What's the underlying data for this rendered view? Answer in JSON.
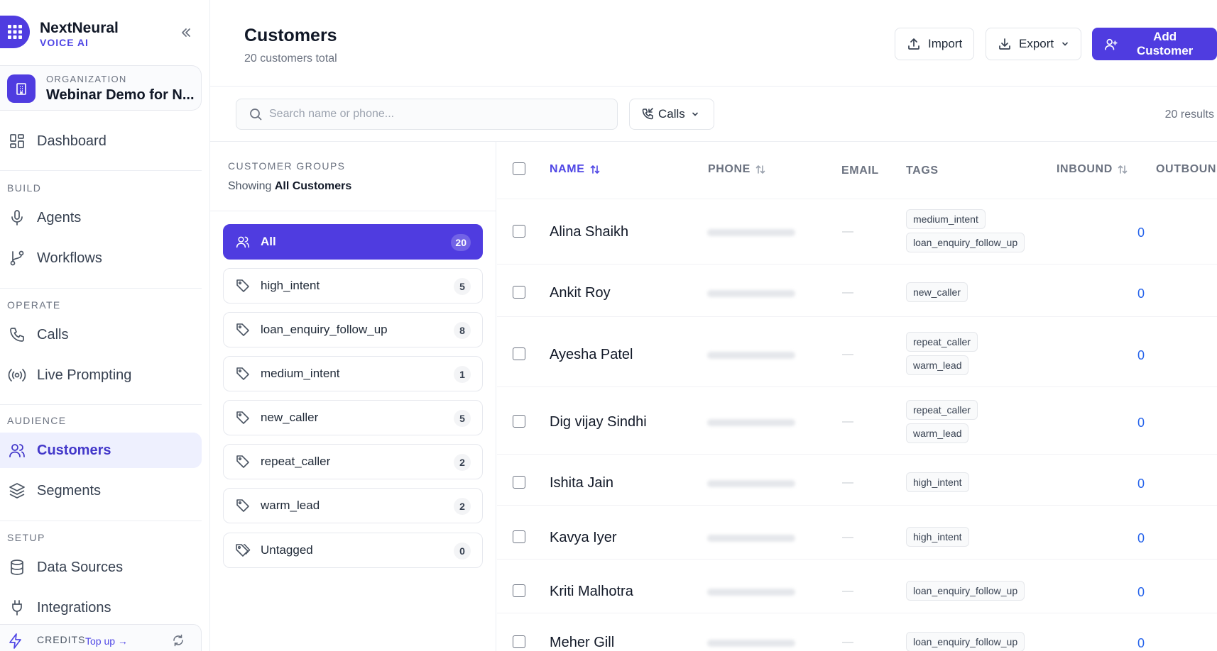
{
  "brand": {
    "name": "NextNeural",
    "tagline": "VOICE AI"
  },
  "org": {
    "label": "ORGANIZATION",
    "name": "Webinar Demo for N..."
  },
  "nav": {
    "dashboard": "Dashboard",
    "build_label": "BUILD",
    "agents": "Agents",
    "workflows": "Workflows",
    "operate_label": "OPERATE",
    "calls": "Calls",
    "live_prompting": "Live Prompting",
    "audience_label": "AUDIENCE",
    "customers": "Customers",
    "segments": "Segments",
    "setup_label": "SETUP",
    "data_sources": "Data Sources",
    "integrations": "Integrations"
  },
  "credits": {
    "label": "CREDITS",
    "topup": "Top up →"
  },
  "header": {
    "title": "Customers",
    "subtitle": "20 customers total",
    "import": "Import",
    "export": "Export",
    "add": "Add Customer"
  },
  "toolbar": {
    "search_placeholder": "Search name or phone...",
    "filter": "Calls",
    "results": "20 results"
  },
  "groups": {
    "title": "CUSTOMER GROUPS",
    "showing_prefix": "Showing",
    "showing_value": "All Customers",
    "items": [
      {
        "label": "All",
        "count": "20"
      },
      {
        "label": "high_intent",
        "count": "5"
      },
      {
        "label": "loan_enquiry_follow_up",
        "count": "8"
      },
      {
        "label": "medium_intent",
        "count": "1"
      },
      {
        "label": "new_caller",
        "count": "5"
      },
      {
        "label": "repeat_caller",
        "count": "2"
      },
      {
        "label": "warm_lead",
        "count": "2"
      },
      {
        "label": "Untagged",
        "count": "0"
      }
    ]
  },
  "table": {
    "columns": {
      "name": "NAME",
      "phone": "PHONE",
      "email": "EMAIL",
      "tags": "TAGS",
      "inbound": "INBOUND",
      "outbound": "OUTBOUND"
    },
    "rows": [
      {
        "name": "Alina Shaikh",
        "email": "—",
        "tags": [
          "medium_intent",
          "loan_enquiry_follow_up"
        ],
        "inbound": "0"
      },
      {
        "name": "Ankit Roy",
        "email": "—",
        "tags": [
          "new_caller"
        ],
        "inbound": "0"
      },
      {
        "name": "Ayesha Patel",
        "email": "—",
        "tags": [
          "repeat_caller",
          "warm_lead"
        ],
        "inbound": "0"
      },
      {
        "name": "Dig vijay Sindhi",
        "email": "—",
        "tags": [
          "repeat_caller",
          "warm_lead"
        ],
        "inbound": "0"
      },
      {
        "name": "Ishita Jain",
        "email": "—",
        "tags": [
          "high_intent"
        ],
        "inbound": "0"
      },
      {
        "name": "Kavya Iyer",
        "email": "—",
        "tags": [
          "high_intent"
        ],
        "inbound": "0"
      },
      {
        "name": "Kriti Malhotra",
        "email": "—",
        "tags": [
          "loan_enquiry_follow_up"
        ],
        "inbound": "0"
      },
      {
        "name": "Meher Gill",
        "email": "—",
        "tags": [
          "loan_enquiry_follow_up"
        ],
        "inbound": "0"
      }
    ]
  },
  "colors": {
    "accent": "#4f3ce0",
    "link": "#2563eb",
    "muted": "#6b7280"
  }
}
